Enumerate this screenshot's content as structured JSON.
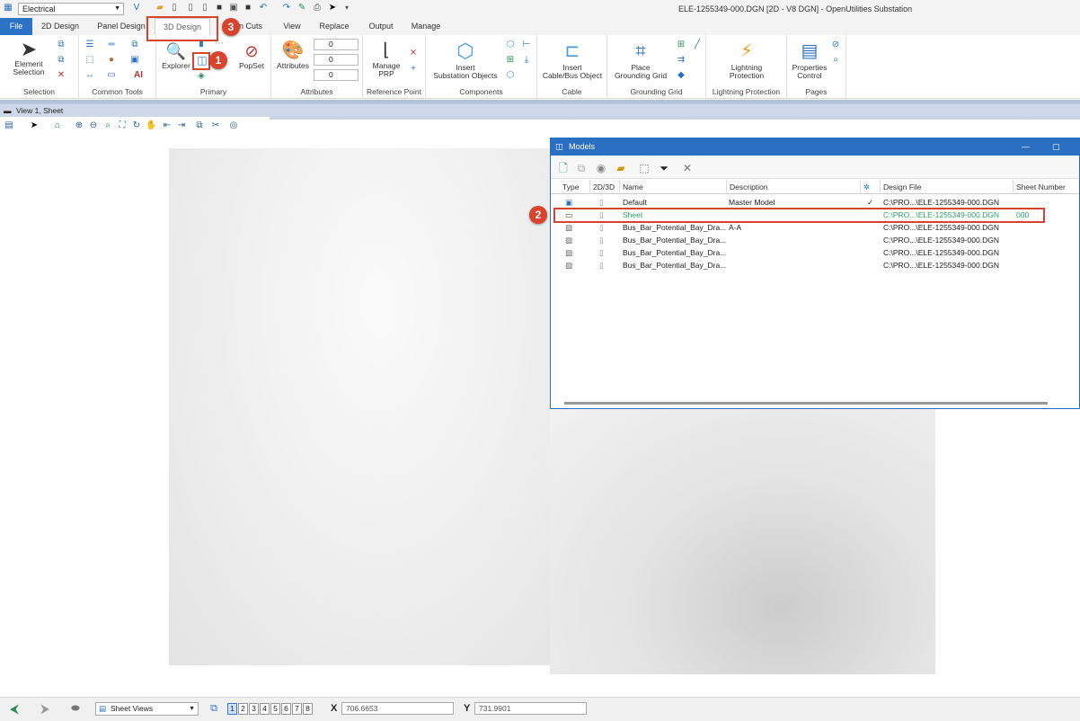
{
  "workspace": "Electrical",
  "window_title": "ELE-1255349-000.DGN [2D - V8 DGN] - OpenUtilities Substation",
  "tabs": [
    "File",
    "2D Design",
    "Panel Design",
    "3D Design",
    "Cuts",
    "View",
    "Replace",
    "Output",
    "Manage"
  ],
  "tab_cuts_partial": "n Cuts",
  "ribbon": {
    "groups": [
      "Selection",
      "Common Tools",
      "Primary",
      "Attributes",
      "Reference Point",
      "Components",
      "Cable",
      "Grounding Grid",
      "Lightning Protection",
      "Pages"
    ],
    "element_selection": "Element\nSelection",
    "explorer": "Explorer",
    "popset": "PopSet",
    "attributes": "Attributes",
    "combo1": "0",
    "combo2": "0",
    "combo3": "0",
    "manage_prp": "Manage\nPRP",
    "insert_substation": "Insert\nSubstation Objects",
    "insert_cable": "Insert\nCable/Bus Object",
    "place_grounding": "Place\nGrounding Grid",
    "lightning": "Lightning\nProtection",
    "properties_control": "Properties\nControl",
    "ai_label": "AI"
  },
  "view_title": "View 1, Sheet",
  "models": {
    "title": "Models",
    "columns": [
      "Type",
      "2D/3D",
      "Name",
      "Description",
      "Design File",
      "Sheet Number"
    ],
    "rows": [
      {
        "name": "Default",
        "desc": "Master Model",
        "check": "✓",
        "file": "C:\\PRO...\\ELE-1255349-000.DGN",
        "sheet": ""
      },
      {
        "name": "Sheet",
        "desc": "",
        "check": "",
        "file": "C:\\PRO...\\ELE-1255349-000.DGN",
        "sheet": "000"
      },
      {
        "name": "Bus_Bar_Potential_Bay_Dra...",
        "desc": "A-A",
        "check": "",
        "file": "C:\\PRO...\\ELE-1255349-000.DGN",
        "sheet": ""
      },
      {
        "name": "Bus_Bar_Potential_Bay_Dra...",
        "desc": "",
        "check": "",
        "file": "C:\\PRO...\\ELE-1255349-000.DGN",
        "sheet": ""
      },
      {
        "name": "Bus_Bar_Potential_Bay_Dra...",
        "desc": "",
        "check": "",
        "file": "C:\\PRO...\\ELE-1255349-000.DGN",
        "sheet": ""
      },
      {
        "name": "Bus_Bar_Potential_Bay_Dra...",
        "desc": "",
        "check": "",
        "file": "C:\\PRO...\\ELE-1255349-000.DGN",
        "sheet": ""
      }
    ]
  },
  "badges": [
    "1",
    "2",
    "3"
  ],
  "status": {
    "sheet_views": "Sheet Views",
    "pages": [
      "1",
      "2",
      "3",
      "4",
      "5",
      "6",
      "7",
      "8"
    ],
    "x_label": "X",
    "x_value": "706.6653",
    "y_label": "Y",
    "y_value": "731.9901"
  },
  "colors": {
    "accent": "#2b71c4",
    "highlight": "#d9432e",
    "sheet_green": "#2e9e6a"
  }
}
